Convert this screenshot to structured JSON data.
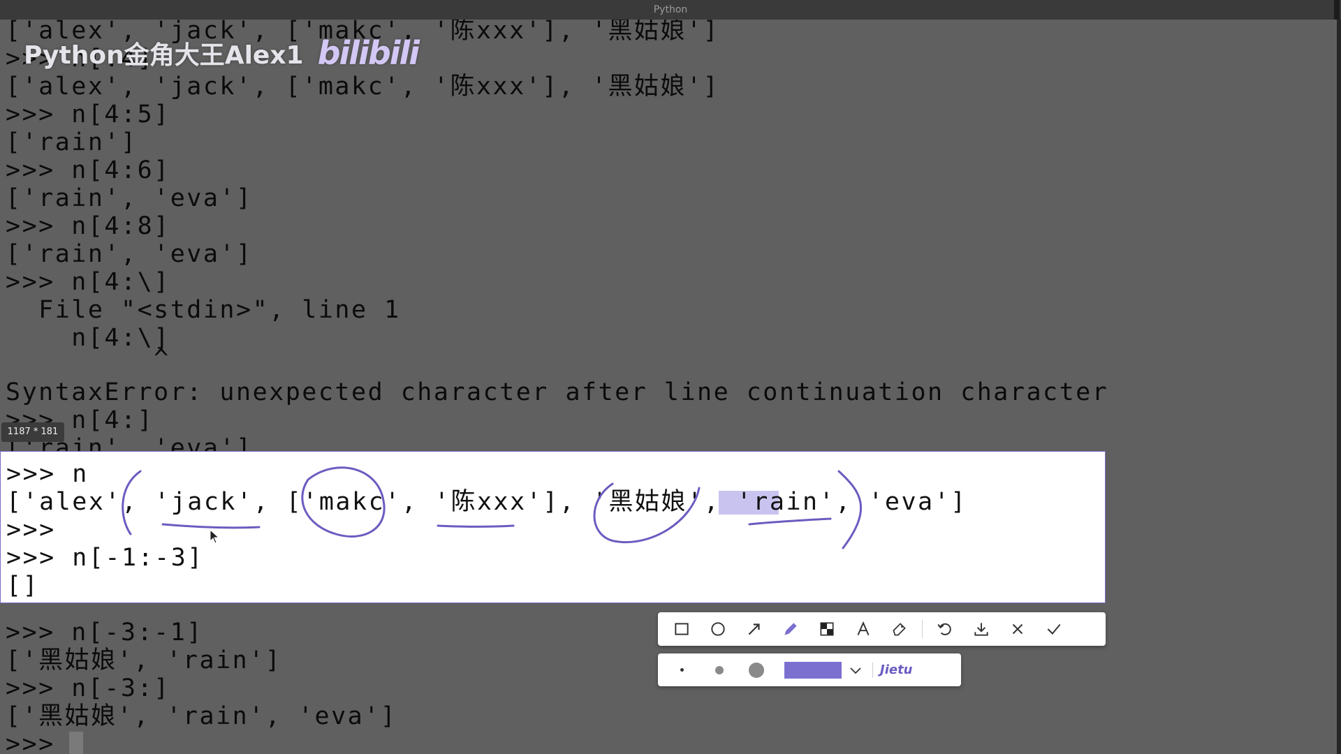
{
  "window": {
    "title": "Python"
  },
  "watermark": {
    "channel_name": "Python金角大王Alex1",
    "logo_text": "bilibili"
  },
  "terminal": {
    "lines": [
      "['alex', 'jack', ['makc', '陈xxx'], '黑姑娘']",
      ">>> n[:4]",
      "['alex', 'jack', ['makc', '陈xxx'], '黑姑娘']",
      ">>> n[4:5]",
      "['rain']",
      ">>> n[4:6]",
      "['rain', 'eva']",
      ">>> n[4:8]",
      "['rain', 'eva']",
      ">>> n[4:\\]",
      "  File \"<stdin>\", line 1",
      "    n[4:\\]",
      "         ^",
      "SyntaxError: unexpected character after line continuation character",
      ">>> n[4:]",
      "['rain', 'eva']"
    ],
    "selected_lines": [
      ">>> n",
      "['alex', 'jack', ['makc', '陈xxx'], '黑姑娘', 'rain', 'eva']",
      ">>>",
      ">>> n[-1:-3]",
      "[]"
    ],
    "after_lines": [
      ">>> n[-3:-1]",
      "['黑姑娘', 'rain']",
      ">>> n[-3:]",
      "['黑姑娘', 'rain', 'eva']",
      ">>> "
    ]
  },
  "screenshot_tool": {
    "size_label": "1187 * 181",
    "tools": [
      {
        "name": "rectangle-tool",
        "icon": "square-icon"
      },
      {
        "name": "ellipse-tool",
        "icon": "circle-icon"
      },
      {
        "name": "arrow-tool",
        "icon": "arrow-icon"
      },
      {
        "name": "pen-tool",
        "icon": "pencil-icon",
        "active": true
      },
      {
        "name": "mosaic-tool",
        "icon": "mosaic-icon"
      },
      {
        "name": "text-tool",
        "icon": "text-icon"
      },
      {
        "name": "eraser-tool",
        "icon": "eraser-icon"
      },
      {
        "name": "undo-button",
        "icon": "undo-icon"
      },
      {
        "name": "save-button",
        "icon": "download-icon"
      },
      {
        "name": "cancel-button",
        "icon": "close-icon"
      },
      {
        "name": "confirm-button",
        "icon": "check-icon"
      }
    ],
    "pen_sizes": [
      "small",
      "medium",
      "large"
    ],
    "pen_color": "#7b6fd0",
    "brand": "Jietu"
  },
  "colors": {
    "terminal_bg": "#606060",
    "selection_bg": "#ffffff",
    "annotation": "#6a5cc0",
    "accent": "#6a5cc0"
  }
}
